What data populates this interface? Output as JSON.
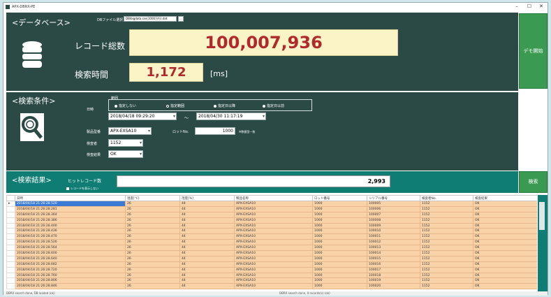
{
  "window": {
    "title": "APX-DBRX-PE",
    "minimize": "–",
    "maximize": "☐",
    "close": "✕"
  },
  "database": {
    "section_label": "<データベース>",
    "file_label": "DBファイル選択",
    "file_value": "DB/bigdata.csv(1000万行).dat",
    "browse_label": "...",
    "record_count_label": "レコード総数",
    "record_count_value": "100,007,936",
    "search_time_label": "検索時間",
    "search_time_value": "1,172",
    "search_time_unit": "[ms]",
    "demo_button": "デモ開始"
  },
  "conditions": {
    "section_label": "<検索条件>",
    "range_label": "範囲",
    "radios": [
      {
        "label": "指定しない",
        "selected": true
      },
      {
        "label": "指定範囲",
        "selected": false
      },
      {
        "label": "指定日以降",
        "selected": true
      },
      {
        "label": "指定日以前",
        "selected": true
      }
    ],
    "date_label": "日時",
    "date_from": "2018/04/18 09:29:20",
    "date_sep": "～",
    "date_to": "2018/04/30 11:17:19",
    "product_label": "製品型番",
    "product_value": "APX-EXSA10",
    "lot_label": "ロットNo.",
    "lot_value": "1000",
    "lot_note": "※数値型一致",
    "inspector_label": "検査者",
    "inspector_value": "1152",
    "result_label": "検査結果",
    "result_value": "OK"
  },
  "results": {
    "section_label": "<検索結果>",
    "hit_label": "ヒットレコード数",
    "hit_value": "2,993",
    "hide_checkbox_label": "レコードを表示しない",
    "search_button": "検索"
  },
  "table": {
    "columns": [
      "日時",
      "温度[℃]",
      "湿度[%]",
      "製品名称",
      "ロット番号",
      "シリアル番号",
      "検査者No.",
      "検査結果"
    ],
    "rows": [
      [
        "2018/04/18 21:26:28.520",
        "26",
        "44",
        "APX-EXSA10",
        "1000",
        "100005",
        "1152",
        "OK"
      ],
      [
        "2018/04/18 21:26:28.281",
        "26",
        "44",
        "APX-EXSA10",
        "1000",
        "100006",
        "1152",
        "OK"
      ],
      [
        "2018/04/18 21:26:28.364",
        "26",
        "44",
        "APX-EXSA10",
        "1000",
        "100007",
        "1152",
        "OK"
      ],
      [
        "2018/04/18 21:26:28.386",
        "26",
        "44",
        "APX-EXSA10",
        "1000",
        "100008",
        "1152",
        "OK"
      ],
      [
        "2018/04/18 21:26:28.400",
        "26",
        "44",
        "APX-EXSA10",
        "1000",
        "100009",
        "1152",
        "OK"
      ],
      [
        "2018/04/18 21:26:28.436",
        "26",
        "44",
        "APX-EXSA10",
        "1000",
        "100010",
        "1152",
        "OK"
      ],
      [
        "2018/04/18 21:26:28.470",
        "26",
        "44",
        "APX-EXSA10",
        "1000",
        "100011",
        "1152",
        "OK"
      ],
      [
        "2018/04/18 21:26:28.526",
        "26",
        "44",
        "APX-EXSA10",
        "1000",
        "100012",
        "1152",
        "OK"
      ],
      [
        "2018/04/18 21:26:28.564",
        "26",
        "44",
        "APX-EXSA10",
        "1000",
        "100013",
        "1152",
        "OK"
      ],
      [
        "2018/04/18 21:26:28.600",
        "26",
        "44",
        "APX-EXSA10",
        "1000",
        "100014",
        "1152",
        "OK"
      ],
      [
        "2018/04/18 21:26:28.640",
        "26",
        "44",
        "APX-EXSA10",
        "1000",
        "100015",
        "1152",
        "OK"
      ],
      [
        "2018/04/18 21:26:28.682",
        "26",
        "44",
        "APX-EXSA10",
        "1000",
        "100016",
        "1152",
        "OK"
      ],
      [
        "2018/04/18 21:26:28.720",
        "26",
        "44",
        "APX-EXSA10",
        "1000",
        "100017",
        "1152",
        "OK"
      ],
      [
        "2018/04/18 21:26:28.760",
        "26",
        "44",
        "APX-EXSA10",
        "1000",
        "100018",
        "1152",
        "OK"
      ],
      [
        "2018/04/18 21:26:28.806",
        "26",
        "44",
        "APX-EXSA10",
        "1000",
        "100019",
        "1152",
        "OK"
      ],
      [
        "2018/04/18 21:26:28.846",
        "26",
        "44",
        "APX-EXSA10",
        "1000",
        "100020",
        "1152",
        "OK"
      ]
    ]
  },
  "status": {
    "left": "DBRX search done, DB loaded (ok)",
    "mid": "DBRX search done, 0 records(s) (ok)"
  },
  "colors": {
    "panel": "#2b4a46",
    "accent": "#0f7d73",
    "button": "#3a9a52",
    "value_text": "#b0292b",
    "value_bg": "#fbf4c6",
    "row_bg": "#fad2a8"
  }
}
